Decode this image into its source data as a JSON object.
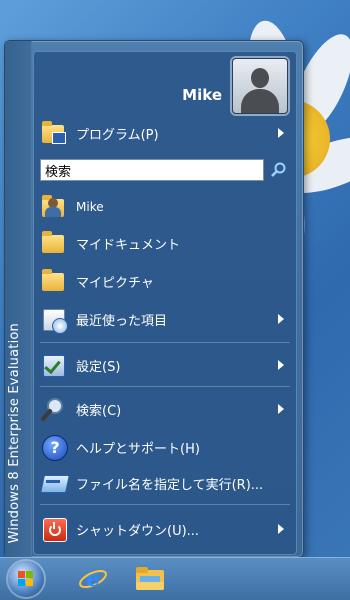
{
  "banner": "Windows 8 Enterprise Evaluation",
  "user": {
    "name": "Mike"
  },
  "menu": {
    "programs": "プログラム(P)",
    "search_value": "検索",
    "pinned": [
      {
        "label": "Mike",
        "icon": "user-folder-icon"
      },
      {
        "label": "マイドキュメント",
        "icon": "folder-icon"
      },
      {
        "label": "マイピクチャ",
        "icon": "folder-icon"
      },
      {
        "label": "最近使った項目",
        "icon": "recent-items-icon"
      }
    ],
    "settings": "設定(S)",
    "search": "検索(C)",
    "help": "ヘルプとサポート(H)",
    "run": "ファイル名を指定して実行(R)...",
    "shutdown": "シャットダウン(U)..."
  },
  "taskbar": {
    "items": [
      "start-button",
      "internet-explorer",
      "file-explorer"
    ]
  }
}
